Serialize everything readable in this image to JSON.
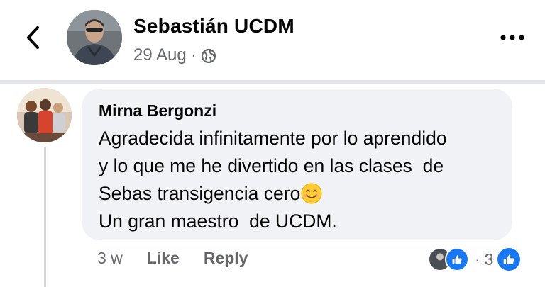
{
  "post": {
    "author_name": "Sebastián UCDM",
    "date": "29 Aug",
    "separator": "·",
    "privacy_icon": "globe-icon"
  },
  "comment": {
    "author_name": "Mirna Bergonzi",
    "lines": [
      "Agradecida infinitamente por lo aprendido",
      "y lo que me he divertido en las clases  de",
      "Sebas transigencia cero",
      "Un gran maestro  de UCDM."
    ],
    "emoji": "smiling-face-emoji",
    "time": "3 w",
    "like_label": "Like",
    "reply_label": "Reply",
    "reaction_separator": "·",
    "reaction_count": "3"
  },
  "colors": {
    "accent": "#1877f2",
    "bubble": "#f0f2f5",
    "secondary_text": "#65676b"
  }
}
